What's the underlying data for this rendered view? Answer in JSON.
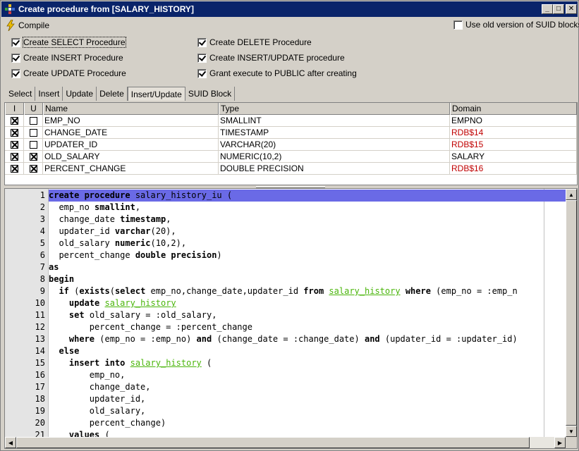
{
  "window": {
    "title": "Create procedure from [SALARY_HISTORY]",
    "minimize": "_",
    "maximize": "□",
    "close": "✕"
  },
  "toolbar": {
    "compile_label": "Compile",
    "compile_icon": "lightning-icon",
    "old_suid_label": "Use old version of SUID blocks",
    "old_suid_checked": false
  },
  "options": {
    "left": [
      {
        "label": "Create SELECT Procedure",
        "checked": true
      },
      {
        "label": "Create INSERT Procedure",
        "checked": true
      },
      {
        "label": "Create UPDATE Procedure",
        "checked": true
      }
    ],
    "right": [
      {
        "label": "Create DELETE Procedure",
        "checked": true
      },
      {
        "label": "Create INSERT/UPDATE procedure",
        "checked": true
      },
      {
        "label": "Grant execute to PUBLIC after creating",
        "checked": true
      }
    ]
  },
  "tabs": [
    "Select",
    "Insert",
    "Update",
    "Delete",
    "Insert/Update",
    "SUID Block"
  ],
  "active_tab": "Insert/Update",
  "grid": {
    "headers": {
      "i": "I",
      "u": "U",
      "name": "Name",
      "type": "Type",
      "domain": "Domain"
    },
    "rows": [
      {
        "i": true,
        "u": false,
        "name": "EMP_NO",
        "type": "SMALLINT",
        "domain": "EMPNO",
        "domain_color": "#000000"
      },
      {
        "i": true,
        "u": false,
        "name": "CHANGE_DATE",
        "type": "TIMESTAMP",
        "domain": "RDB$14",
        "domain_color": "#c00000"
      },
      {
        "i": true,
        "u": false,
        "name": "UPDATER_ID",
        "type": "VARCHAR(20)",
        "domain": "RDB$15",
        "domain_color": "#c00000"
      },
      {
        "i": true,
        "u": true,
        "name": "OLD_SALARY",
        "type": "NUMERIC(10,2)",
        "domain": "SALARY",
        "domain_color": "#000000"
      },
      {
        "i": true,
        "u": true,
        "name": "PERCENT_CHANGE",
        "type": "DOUBLE PRECISION",
        "domain": "RDB$16",
        "domain_color": "#c00000"
      }
    ]
  },
  "editor": {
    "highlight_color": "#6a6ae6",
    "lines": [
      {
        "n": "1",
        "tokens": [
          [
            "kw",
            "create procedure"
          ],
          [
            "t",
            " salary_history_iu ("
          ]
        ]
      },
      {
        "n": "2",
        "tokens": [
          [
            "t",
            "  emp_no "
          ],
          [
            "kw",
            "smallint"
          ],
          [
            "t",
            ","
          ]
        ]
      },
      {
        "n": "3",
        "tokens": [
          [
            "t",
            "  change_date "
          ],
          [
            "kw",
            "timestamp"
          ],
          [
            "t",
            ","
          ]
        ]
      },
      {
        "n": "4",
        "tokens": [
          [
            "t",
            "  updater_id "
          ],
          [
            "kw",
            "varchar"
          ],
          [
            "t",
            "(20),"
          ]
        ]
      },
      {
        "n": "5",
        "tokens": [
          [
            "t",
            "  old_salary "
          ],
          [
            "kw",
            "numeric"
          ],
          [
            "t",
            "(10,2),"
          ]
        ]
      },
      {
        "n": "6",
        "tokens": [
          [
            "t",
            "  percent_change "
          ],
          [
            "kw",
            "double precision"
          ],
          [
            "t",
            ")"
          ]
        ]
      },
      {
        "n": "7",
        "tokens": [
          [
            "kw",
            "as"
          ]
        ]
      },
      {
        "n": "8",
        "tokens": [
          [
            "kw",
            "begin"
          ]
        ]
      },
      {
        "n": "9",
        "tokens": [
          [
            "t",
            "  "
          ],
          [
            "kw",
            "if"
          ],
          [
            "t",
            " ("
          ],
          [
            "kw",
            "exists"
          ],
          [
            "t",
            "("
          ],
          [
            "kw",
            "select"
          ],
          [
            "t",
            " emp_no,change_date,updater_id "
          ],
          [
            "kw",
            "from"
          ],
          [
            "t",
            " "
          ],
          [
            "tbl",
            "salary_history"
          ],
          [
            "t",
            " "
          ],
          [
            "kw",
            "where"
          ],
          [
            "t",
            " (emp_no = :emp_n"
          ]
        ]
      },
      {
        "n": "10",
        "tokens": [
          [
            "t",
            "    "
          ],
          [
            "kw",
            "update"
          ],
          [
            "t",
            " "
          ],
          [
            "tbl",
            "salary_history"
          ]
        ]
      },
      {
        "n": "11",
        "tokens": [
          [
            "t",
            "    "
          ],
          [
            "kw",
            "set"
          ],
          [
            "t",
            " old_salary = :old_salary,"
          ]
        ]
      },
      {
        "n": "12",
        "tokens": [
          [
            "t",
            "        percent_change = :percent_change"
          ]
        ]
      },
      {
        "n": "13",
        "tokens": [
          [
            "t",
            "    "
          ],
          [
            "kw",
            "where"
          ],
          [
            "t",
            " (emp_no = :emp_no) "
          ],
          [
            "kw",
            "and"
          ],
          [
            "t",
            " (change_date = :change_date) "
          ],
          [
            "kw",
            "and"
          ],
          [
            "t",
            " (updater_id = :updater_id)"
          ]
        ]
      },
      {
        "n": "14",
        "tokens": [
          [
            "t",
            "  "
          ],
          [
            "kw",
            "else"
          ]
        ]
      },
      {
        "n": "15",
        "tokens": [
          [
            "t",
            "    "
          ],
          [
            "kw",
            "insert into"
          ],
          [
            "t",
            " "
          ],
          [
            "tbl",
            "salary_history"
          ],
          [
            "t",
            " ("
          ]
        ]
      },
      {
        "n": "16",
        "tokens": [
          [
            "t",
            "        emp_no,"
          ]
        ]
      },
      {
        "n": "17",
        "tokens": [
          [
            "t",
            "        change_date,"
          ]
        ]
      },
      {
        "n": "18",
        "tokens": [
          [
            "t",
            "        updater_id,"
          ]
        ]
      },
      {
        "n": "19",
        "tokens": [
          [
            "t",
            "        old_salary,"
          ]
        ]
      },
      {
        "n": "20",
        "tokens": [
          [
            "t",
            "        percent_change)"
          ]
        ]
      },
      {
        "n": "21",
        "tokens": [
          [
            "t",
            "    "
          ],
          [
            "kw",
            "values"
          ],
          [
            "t",
            " ("
          ]
        ]
      }
    ]
  },
  "scroll_arrows": {
    "up": "▲",
    "down": "▼",
    "left": "◀",
    "right": "▶"
  }
}
